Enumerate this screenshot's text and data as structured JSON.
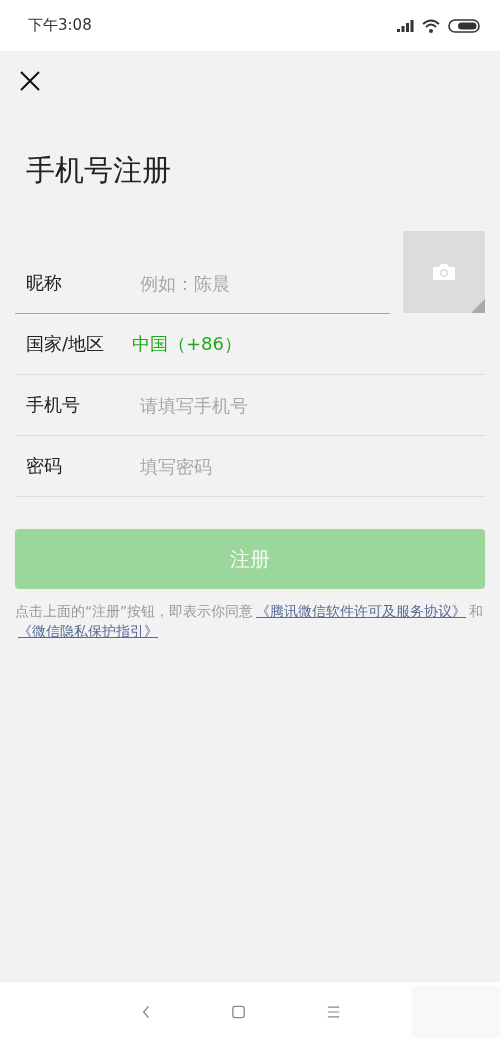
{
  "status_bar": {
    "time": "下午3:08"
  },
  "title": "手机号注册",
  "fields": [
    {
      "kind": "input",
      "label": "昵称",
      "placeholder": "例如：陈晨",
      "focused": true
    },
    {
      "kind": "select",
      "label": "国家/地区",
      "value": "中国（+86）",
      "focused": false
    },
    {
      "kind": "input",
      "label": "手机号",
      "placeholder": "请填写手机号",
      "focused": false
    },
    {
      "kind": "input",
      "label": "密码",
      "placeholder": "填写密码",
      "focused": false
    }
  ],
  "register_button": {
    "label": "注册",
    "disabled": true
  },
  "agreement": [
    {
      "kind": "text",
      "text": "点击上面的“注册”按钮，即表示你同意"
    },
    {
      "kind": "link",
      "text": "《腾讯微信软件许可及服务协议》"
    },
    {
      "kind": "text",
      "text": "和"
    },
    {
      "kind": "link",
      "text": "《微信隐私保护指引》"
    }
  ]
}
